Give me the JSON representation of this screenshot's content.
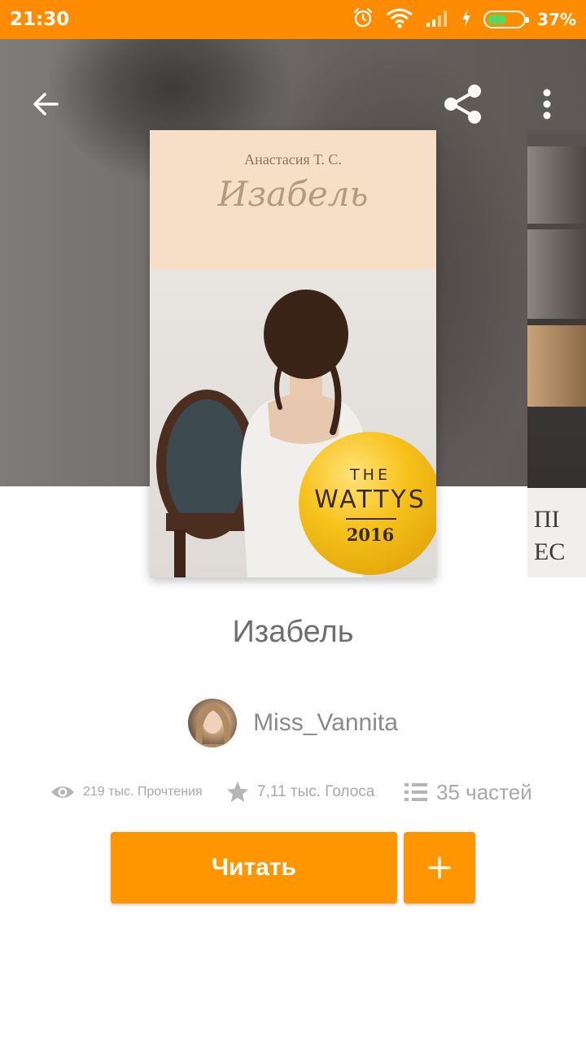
{
  "status_bar": {
    "time": "21:30",
    "battery_percent": "37%",
    "battery_level": 0.37,
    "icons": [
      "alarm-icon",
      "wifi-icon",
      "signal-icon",
      "charging-icon",
      "battery-icon"
    ]
  },
  "toolbar": {
    "back_icon": "arrow-left-icon",
    "share_icon": "share-icon",
    "more_icon": "more-vertical-icon"
  },
  "cover": {
    "author": "Анастасия Т. С.",
    "title": "Изабель",
    "badge": {
      "line1": "THE",
      "line2": "WATTYS",
      "year": "2016"
    }
  },
  "next_cover": {
    "text_line1": "ПІ",
    "text_line2": "ЕС"
  },
  "book": {
    "title": "Изабель",
    "author": "Miss_Vannita"
  },
  "stats": {
    "reads": "219 тыс. Прочтения",
    "votes": "7,11 тыс. Голоса",
    "parts": "35 частей"
  },
  "actions": {
    "read_label": "Читать",
    "add_icon": "plus-icon"
  },
  "colors": {
    "accent": "#ff9500",
    "status_bar": "#ff8c00",
    "text_secondary": "#8a8a8a"
  }
}
